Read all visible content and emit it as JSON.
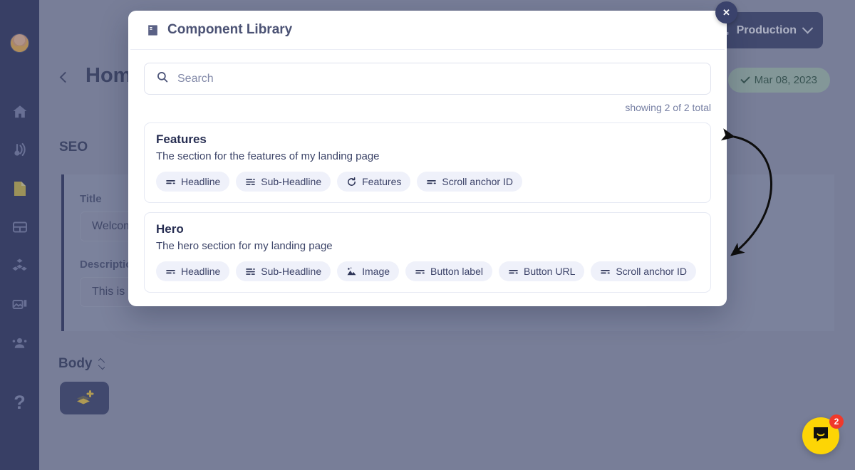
{
  "sidebar": {
    "avatar_name": "user-avatar",
    "items": [
      {
        "name": "home-icon",
        "label": "Home"
      },
      {
        "name": "broadcast-icon",
        "label": "Broadcast"
      },
      {
        "name": "document-icon",
        "label": "Documents"
      },
      {
        "name": "table-icon",
        "label": "Tables"
      },
      {
        "name": "components-icon",
        "label": "Components"
      },
      {
        "name": "media-icon",
        "label": "Media"
      },
      {
        "name": "users-icon",
        "label": "Users"
      }
    ],
    "help_label": "?"
  },
  "topbar": {
    "environment": "Production",
    "environment_icon": "hierarchy-icon",
    "chevron_icon": "chevron-down-icon"
  },
  "page": {
    "back_icon": "chevron-left-icon",
    "title": "Home",
    "menu_icon": "ellipsis-icon",
    "date_badge": "Mar 08, 2023",
    "date_badge_icon": "check-icon",
    "seo_heading": "SEO",
    "fields": [
      {
        "label": "Title",
        "value": "Welcome"
      },
      {
        "label": "Description",
        "value": "This is the"
      }
    ],
    "body_heading": "Body",
    "body_sort_icon": "up-down-chevron-icon",
    "add_block_icon": "add-layers-icon"
  },
  "modal": {
    "title": "Component Library",
    "title_icon": "book-icon",
    "close_label": "✕",
    "search": {
      "icon": "search-icon",
      "placeholder": "Search",
      "value": ""
    },
    "count_text": "showing 2 of 2 total",
    "components": [
      {
        "name": "Features",
        "description": "The section for the features of my landing page",
        "fields": [
          {
            "label": "Headline",
            "icon": "text-lines-icon"
          },
          {
            "label": "Sub-Headline",
            "icon": "text-list-icon"
          },
          {
            "label": "Features",
            "icon": "repeat-icon"
          },
          {
            "label": "Scroll anchor ID",
            "icon": "text-lines-icon"
          }
        ]
      },
      {
        "name": "Hero",
        "description": "The hero section for my landing page",
        "fields": [
          {
            "label": "Headline",
            "icon": "text-lines-icon"
          },
          {
            "label": "Sub-Headline",
            "icon": "text-list-icon"
          },
          {
            "label": "Image",
            "icon": "image-icon"
          },
          {
            "label": "Button label",
            "icon": "text-lines-icon"
          },
          {
            "label": "Button URL",
            "icon": "text-lines-icon"
          },
          {
            "label": "Scroll anchor ID",
            "icon": "text-lines-icon"
          }
        ]
      }
    ]
  },
  "intercom": {
    "icon": "chat-smile-icon",
    "unread_count": "2"
  },
  "colors": {
    "sidebar": "#1c2450",
    "backdrop": "#8a90a8",
    "accent": "#2b3460",
    "chip_bg": "#eff1fa",
    "badge_green": "#9dbba8",
    "intercom_yellow": "#fdd505",
    "unread_red": "#f0392b",
    "add_block_yellow": "#e8c033"
  }
}
